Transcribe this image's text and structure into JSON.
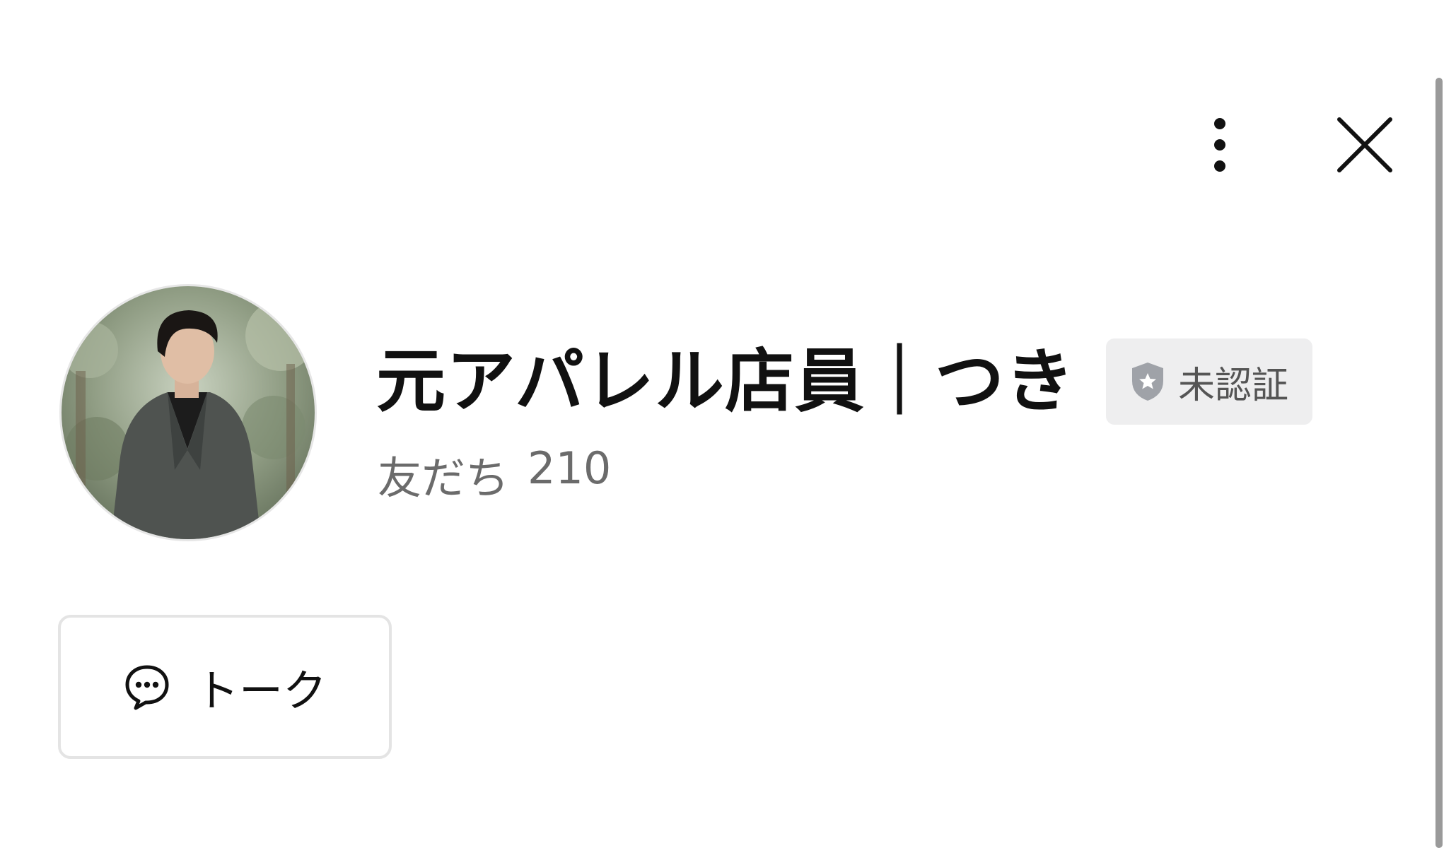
{
  "header": {
    "more_icon": "vertical-ellipsis-icon",
    "close_icon": "close-icon"
  },
  "profile": {
    "name": "元アパレル店員｜つき",
    "status_badge": {
      "label": "未認証",
      "icon": "shield-star-icon"
    },
    "friends": {
      "label": "友だち",
      "count": "210"
    }
  },
  "actions": {
    "talk_label": "トーク",
    "talk_icon": "chat-bubble-icon"
  },
  "colors": {
    "text_primary": "#111111",
    "text_secondary": "#6b6b6b",
    "badge_bg": "#eeeeef",
    "badge_icon": "#9fa2a8",
    "button_border": "#e4e4e4",
    "scrollbar": "#9a9a9a"
  }
}
